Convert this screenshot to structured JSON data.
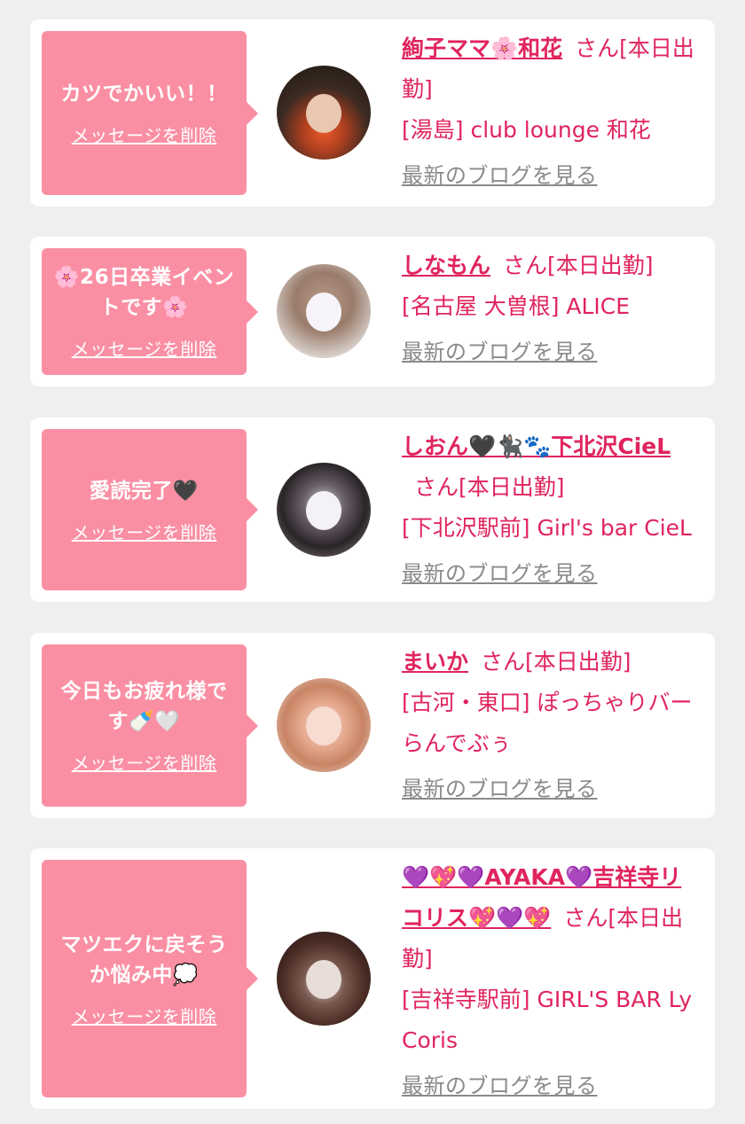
{
  "colors": {
    "bubble": "#fa8fa3",
    "accent": "#e0245e",
    "link_gray": "#8a8a8a",
    "background": "#efefef"
  },
  "items": [
    {
      "message": "カツでかいい！！",
      "delete_label": "メッセージを削除",
      "name": "絢子ママ🌸和花",
      "san": "さん[本日出勤]",
      "store": "[湯島] club lounge 和花",
      "blog_label": "最新のブログを見る"
    },
    {
      "message": "🌸26日卒業イベントです🌸",
      "delete_label": "メッセージを削除",
      "name": "しなもん",
      "san": "さん[本日出勤]",
      "store": "[名古屋 大曽根] ALICE",
      "blog_label": "最新のブログを見る"
    },
    {
      "message": "愛読完了🖤",
      "delete_label": "メッセージを削除",
      "name": "しおん🖤🐈‍⬛🐾下北沢CieL",
      "san": "さん[本日出勤]",
      "store": "[下北沢駅前] Girl's bar CieL",
      "blog_label": "最新のブログを見る"
    },
    {
      "message": "今日もお疲れ様です🍼🤍",
      "delete_label": "メッセージを削除",
      "name": "まいか",
      "san": "さん[本日出勤]",
      "store": "[古河・東口] ぽっちゃりバー らんでぶぅ",
      "blog_label": "最新のブログを見る"
    },
    {
      "message": "マツエクに戻そうか悩み中💭",
      "delete_label": "メッセージを削除",
      "name": "💜💖💜AYAKA💜吉祥寺リコリス💖💜💖",
      "san": "さん[本日出勤]",
      "store": "[吉祥寺駅前] GIRL'S BAR LyCoris",
      "blog_label": "最新のブログを見る"
    }
  ]
}
